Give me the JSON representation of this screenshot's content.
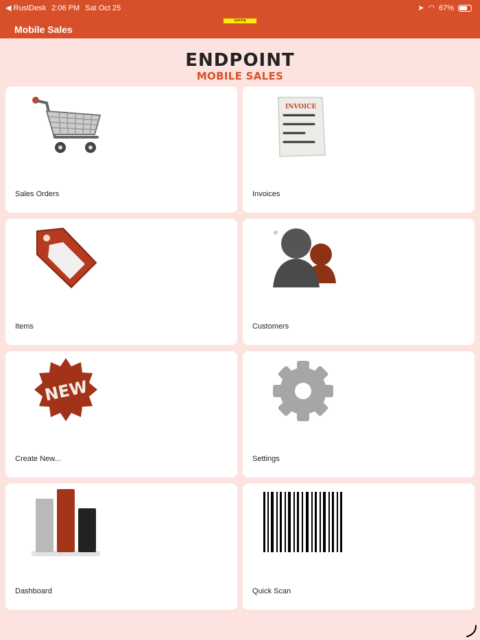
{
  "status_bar": {
    "back_app": "RustDesk",
    "time": "2:06 PM",
    "date": "Sat Oct 25",
    "battery": "67%"
  },
  "sync_badge": "syncing",
  "app_title": "Mobile Sales",
  "logo": {
    "main": "ENDPOINT",
    "sub": "MOBILE SALES"
  },
  "colors": {
    "accent": "#d8502a",
    "background": "#fde3df",
    "tile": "#ffffff",
    "sync": "#ffec00"
  },
  "tiles": [
    {
      "label": "Sales Orders",
      "icon": "shopping-cart-icon"
    },
    {
      "label": "Invoices",
      "icon": "invoice-icon"
    },
    {
      "label": "Items",
      "icon": "price-tag-icon"
    },
    {
      "label": "Customers",
      "icon": "customers-icon"
    },
    {
      "label": "Create New...",
      "icon": "new-badge-icon"
    },
    {
      "label": "Settings",
      "icon": "gear-icon"
    },
    {
      "label": "Dashboard",
      "icon": "bar-chart-icon"
    },
    {
      "label": "Quick Scan",
      "icon": "barcode-icon"
    }
  ],
  "icon_text": {
    "invoice": "INVOICE",
    "new": "NEW"
  }
}
